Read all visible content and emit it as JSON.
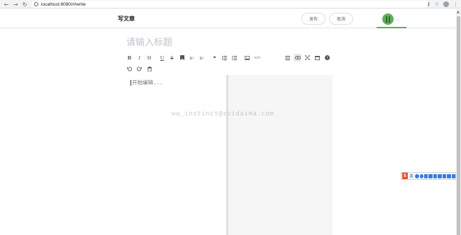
{
  "browser": {
    "url": "localhost:8080/#/write",
    "back_icon": "back-arrow-icon",
    "forward_icon": "forward-arrow-icon",
    "reload_icon": "reload-icon"
  },
  "header": {
    "title": "写文章",
    "publish_label": "发布",
    "cancel_label": "取消",
    "accent_color": "#5fae5a"
  },
  "title_input": {
    "placeholder": "请输入标题",
    "value": ""
  },
  "toolbar": {
    "bold": "B",
    "italic": "I",
    "header": "H",
    "underline": "U",
    "strikethrough": "S",
    "superscript": "x",
    "superscript_mark": "2",
    "subscript": "x",
    "subscript_mark": "2"
  },
  "editor": {
    "placeholder": "开始编辑..."
  },
  "watermark": "wu_instinct@zuidaima.com",
  "ime": {
    "logo": "S",
    "lang": "英"
  }
}
